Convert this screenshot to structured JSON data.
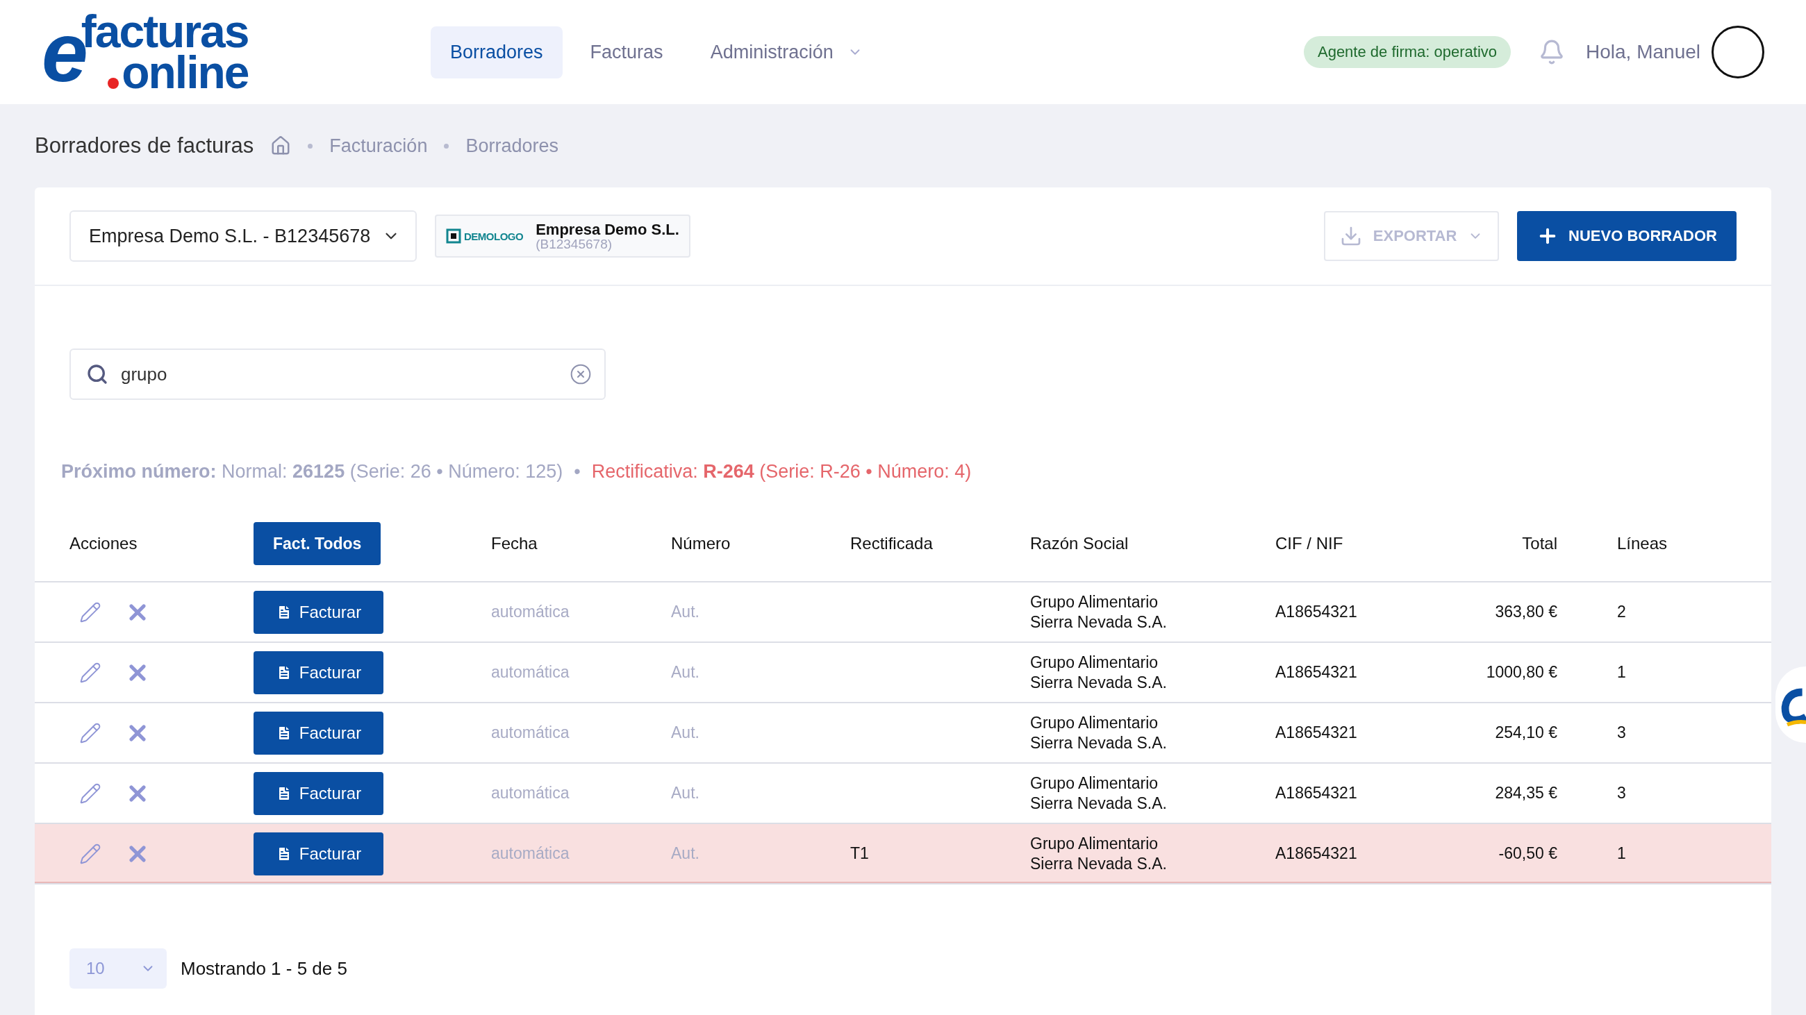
{
  "logo": {
    "mark": "e",
    "line1": "facturas",
    "line2": "online"
  },
  "nav": [
    {
      "label": "Borradores",
      "selected": true,
      "dropdown": false
    },
    {
      "label": "Facturas",
      "selected": false,
      "dropdown": false
    },
    {
      "label": "Administración",
      "selected": false,
      "dropdown": true
    }
  ],
  "status_badge": "Agente de firma: operativo",
  "greeting": "Hola, Manuel",
  "page_title": "Borradores de facturas",
  "breadcrumb": [
    "Facturación",
    "Borradores"
  ],
  "company_select": "Empresa Demo S.L. - B12345678",
  "company_chip": {
    "logo_text": "DEMOLOGO",
    "name": "Empresa Demo S.L.",
    "cif": "(B12345678)"
  },
  "export_button": {
    "label": "EXPORTAR",
    "disabled": true
  },
  "new_button": "NUEVO BORRADOR",
  "search": {
    "value": "grupo"
  },
  "next_number": {
    "normal": "**Próximo número:** Normal: **26125** (Serie: 26 • Número: 125)",
    "separator": "•",
    "rectificativa": "Rectificativa: **R-264** (Serie: R-26 • Número: 4)"
  },
  "table": {
    "columns": [
      "Acciones",
      "Fact. Todos",
      "Fecha",
      "Número",
      "Rectificada",
      "Razón Social",
      "CIF / NIF",
      "Total",
      "Líneas"
    ],
    "rows": [
      {
        "action": "Facturar",
        "fecha": "automática",
        "numero": "Aut.",
        "rectificada": "",
        "razon": [
          "Grupo Alimentario",
          "Sierra Nevada S.A."
        ],
        "cif": "A18654321",
        "total": "363,80 €",
        "lineas": "2",
        "highlighted": false
      },
      {
        "action": "Facturar",
        "fecha": "automática",
        "numero": "Aut.",
        "rectificada": "",
        "razon": [
          "Grupo Alimentario",
          "Sierra Nevada S.A."
        ],
        "cif": "A18654321",
        "total": "1000,80 €",
        "lineas": "1",
        "highlighted": false
      },
      {
        "action": "Facturar",
        "fecha": "automática",
        "numero": "Aut.",
        "rectificada": "",
        "razon": [
          "Grupo Alimentario",
          "Sierra Nevada S.A."
        ],
        "cif": "A18654321",
        "total": "254,10 €",
        "lineas": "3",
        "highlighted": false
      },
      {
        "action": "Facturar",
        "fecha": "automática",
        "numero": "Aut.",
        "rectificada": "",
        "razon": [
          "Grupo Alimentario",
          "Sierra Nevada S.A."
        ],
        "cif": "A18654321",
        "total": "284,35 €",
        "lineas": "3",
        "highlighted": false
      },
      {
        "action": "Facturar",
        "fecha": "automática",
        "numero": "Aut.",
        "rectificada": "T1",
        "razon": [
          "Grupo Alimentario",
          "Sierra Nevada S.A."
        ],
        "cif": "A18654321",
        "total": "-60,50 €",
        "lineas": "1",
        "highlighted": true
      }
    ]
  },
  "pagination": {
    "page_size": "10",
    "summary": "Mostrando 1 - 5 de 5"
  }
}
